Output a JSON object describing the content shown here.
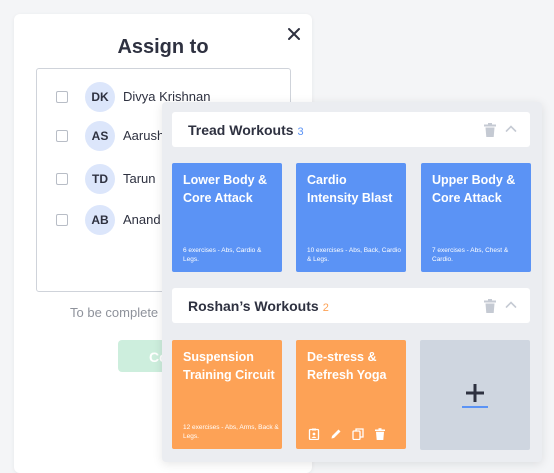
{
  "assign_modal": {
    "title": "Assign to",
    "members": [
      {
        "initials": "DK",
        "name": "Divya Krishnan"
      },
      {
        "initials": "AS",
        "name": "Aarush"
      },
      {
        "initials": "TD",
        "name": "Tarun"
      },
      {
        "initials": "AB",
        "name": "Anand"
      }
    ],
    "due_label": "To be complete",
    "confirm_label": "Con"
  },
  "groups": [
    {
      "title": "Tread Workouts",
      "count": "3",
      "count_color": "#5b93f5",
      "cards": [
        {
          "title": "Lower Body & Core Attack",
          "desc": "6 exercises - Abs, Cardio & Legs.",
          "color": "#5b93f5"
        },
        {
          "title": "Cardio Intensity Blast",
          "desc": "10 exercises - Abs, Back, Cardio & Legs.",
          "color": "#5b93f5"
        },
        {
          "title": "Upper Body & Core Attack",
          "desc": "7 exercises - Abs, Chest & Cardio.",
          "color": "#5b93f5"
        }
      ]
    },
    {
      "title": "Roshan’s Workouts",
      "count": "2",
      "count_color": "#fda256",
      "cards": [
        {
          "title": "Suspension Training Circuit",
          "desc": "12 exercises - Abs, Arms, Back & Legs.",
          "color": "#fda256"
        },
        {
          "title": "De-stress & Refresh Yoga",
          "desc": "",
          "color": "#fda256",
          "actions": [
            "assign-icon",
            "edit-icon",
            "copy-icon",
            "delete-icon"
          ]
        }
      ],
      "add_card_icon": "plus-icon"
    }
  ],
  "icons": {
    "close": "close-icon",
    "trash": "trash-icon",
    "collapse": "chevron-up-icon",
    "add": "plus-icon"
  },
  "colors": {
    "text_dark": "#2e3140",
    "avatar_bg": "#dce6fb",
    "panel_bg": "#ebedf1",
    "add_card_bg": "#cfd6e0",
    "confirm_bg": "#cdeedd"
  }
}
